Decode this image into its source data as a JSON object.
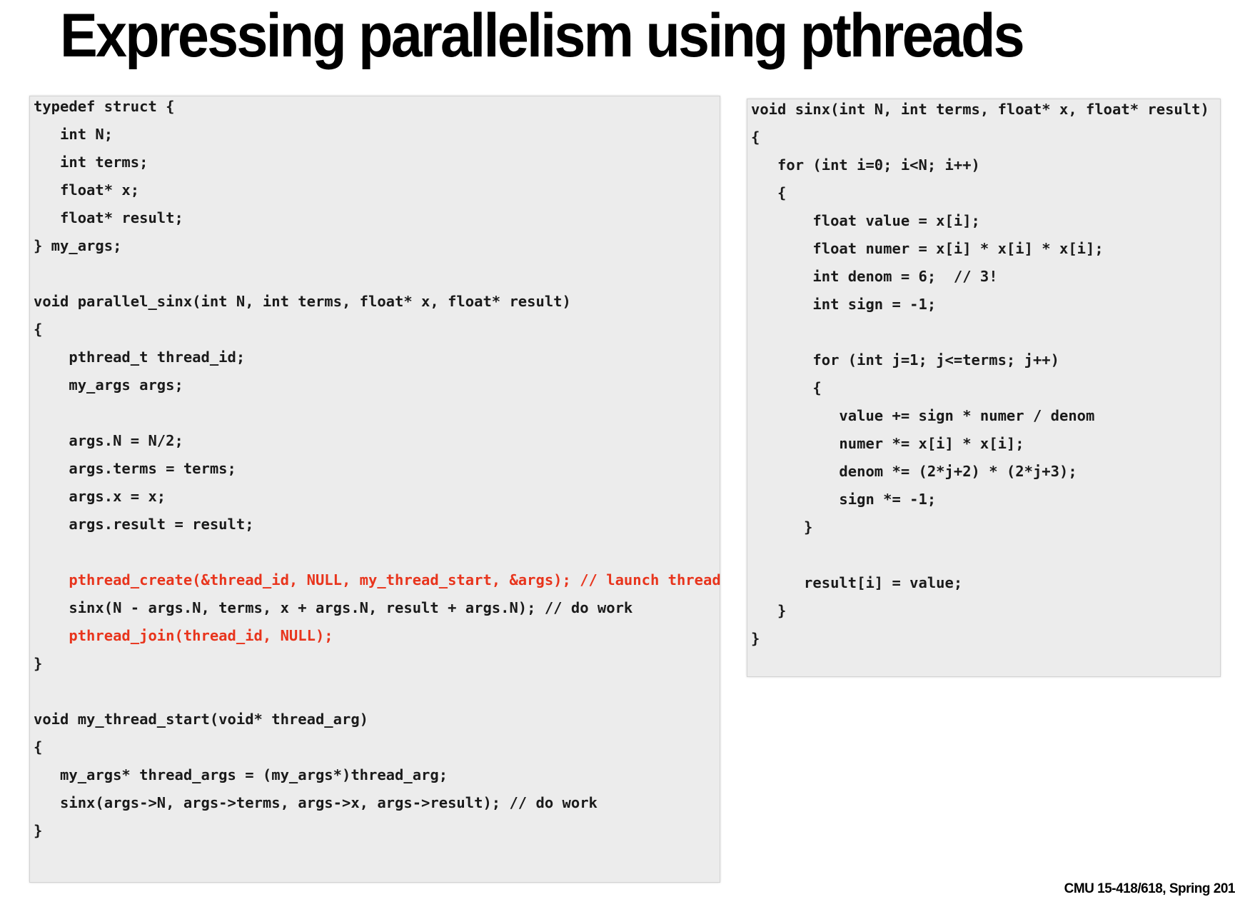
{
  "slide": {
    "title": "Expressing parallelism using pthreads",
    "footer": "CMU 15-418/618, Spring 201"
  },
  "colors": {
    "panel_background": "#ececec",
    "code_text": "#1a1a1a",
    "highlight_red": "#e8341c"
  },
  "left_code": [
    {
      "text": "typedef struct {",
      "red": false
    },
    {
      "text": "   int N;",
      "red": false
    },
    {
      "text": "   int terms;",
      "red": false
    },
    {
      "text": "   float* x;",
      "red": false
    },
    {
      "text": "   float* result;",
      "red": false
    },
    {
      "text": "} my_args;",
      "red": false
    },
    {
      "text": "",
      "red": false
    },
    {
      "text": "void parallel_sinx(int N, int terms, float* x, float* result)",
      "red": false
    },
    {
      "text": "{",
      "red": false
    },
    {
      "text": "    pthread_t thread_id;",
      "red": false
    },
    {
      "text": "    my_args args;",
      "red": false
    },
    {
      "text": "",
      "red": false
    },
    {
      "text": "    args.N = N/2;",
      "red": false
    },
    {
      "text": "    args.terms = terms;",
      "red": false
    },
    {
      "text": "    args.x = x;",
      "red": false
    },
    {
      "text": "    args.result = result;",
      "red": false
    },
    {
      "text": "",
      "red": false
    },
    {
      "text": "    pthread_create(&thread_id, NULL, my_thread_start, &args); // launch thread",
      "red": true
    },
    {
      "text": "    sinx(N - args.N, terms, x + args.N, result + args.N); // do work",
      "red": false
    },
    {
      "text": "    pthread_join(thread_id, NULL);",
      "red": true
    },
    {
      "text": "}",
      "red": false
    },
    {
      "text": "",
      "red": false
    },
    {
      "text": "void my_thread_start(void* thread_arg)",
      "red": false
    },
    {
      "text": "{",
      "red": false
    },
    {
      "text": "   my_args* thread_args = (my_args*)thread_arg;",
      "red": false
    },
    {
      "text": "   sinx(args->N, args->terms, args->x, args->result); // do work",
      "red": false
    },
    {
      "text": "}",
      "red": false
    }
  ],
  "right_code": [
    {
      "text": "void sinx(int N, int terms, float* x, float* result)",
      "red": false
    },
    {
      "text": "{",
      "red": false
    },
    {
      "text": "   for (int i=0; i<N; i++)",
      "red": false
    },
    {
      "text": "   {",
      "red": false
    },
    {
      "text": "       float value = x[i];",
      "red": false
    },
    {
      "text": "       float numer = x[i] * x[i] * x[i];",
      "red": false
    },
    {
      "text": "       int denom = 6;  // 3!",
      "red": false
    },
    {
      "text": "       int sign = -1;",
      "red": false
    },
    {
      "text": "",
      "red": false
    },
    {
      "text": "       for (int j=1; j<=terms; j++)",
      "red": false
    },
    {
      "text": "       {",
      "red": false
    },
    {
      "text": "          value += sign * numer / denom",
      "red": false
    },
    {
      "text": "          numer *= x[i] * x[i];",
      "red": false
    },
    {
      "text": "          denom *= (2*j+2) * (2*j+3);",
      "red": false
    },
    {
      "text": "          sign *= -1;",
      "red": false
    },
    {
      "text": "      }",
      "red": false
    },
    {
      "text": "",
      "red": false
    },
    {
      "text": "      result[i] = value;",
      "red": false
    },
    {
      "text": "   }",
      "red": false
    },
    {
      "text": "}",
      "red": false
    }
  ]
}
